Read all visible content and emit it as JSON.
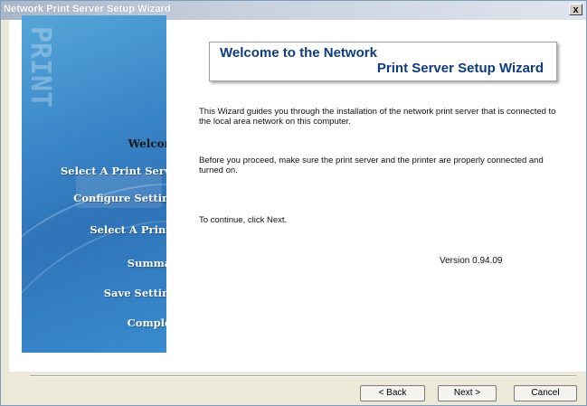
{
  "window": {
    "title": "Network Print Server Setup Wizard",
    "close_glyph": "x"
  },
  "sidebar": {
    "watermark": "PRINT",
    "steps": [
      {
        "label": "Welcome",
        "active": true
      },
      {
        "label": "Select A Print Server",
        "active": false
      },
      {
        "label": "Configure Settings",
        "active": false
      },
      {
        "label": "Select  A  Printer",
        "active": false
      },
      {
        "label": "Summary",
        "active": false
      },
      {
        "label": "Save Settings",
        "active": false
      },
      {
        "label": "Complete",
        "active": false
      }
    ]
  },
  "header": {
    "line1": "Welcome to the Network",
    "line2": "Print Server Setup Wizard"
  },
  "body": {
    "para1": "This Wizard guides you through the installation of the network print server that is connected to the local area network on this computer.",
    "para2": "Before you proceed, make sure the print server and the printer are properly connected and turned on.",
    "para3": "To continue, click Next.",
    "version": "Version 0.94.09"
  },
  "buttons": {
    "back": "< Back",
    "next": "Next >",
    "cancel": "Cancel"
  },
  "colors": {
    "sidebar": "#3a86c8",
    "header_text": "#0f3c7d",
    "window_bg": "#ece9d8"
  }
}
